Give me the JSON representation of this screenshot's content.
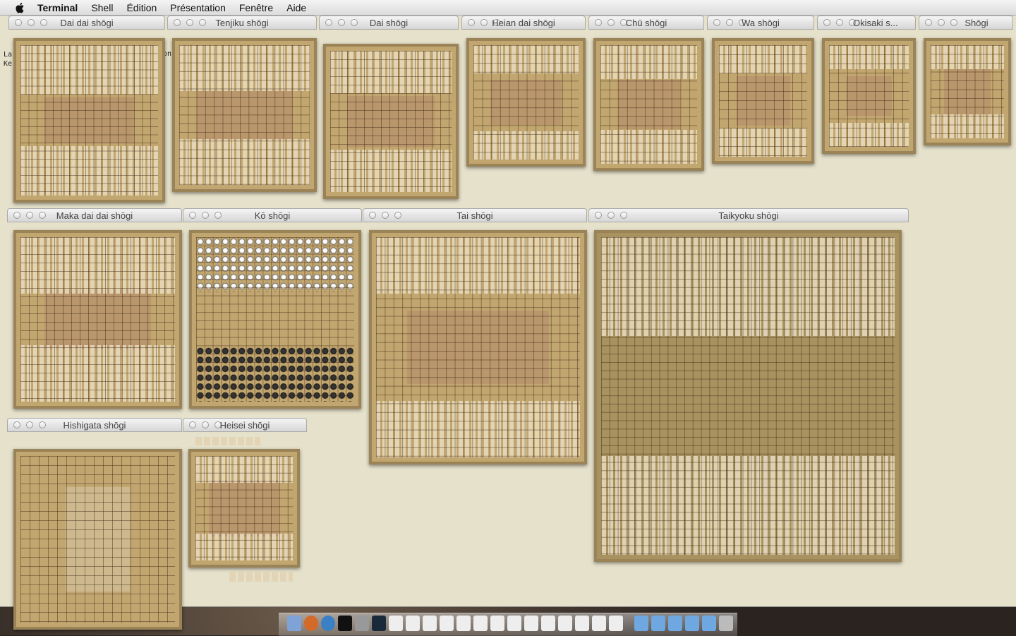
{
  "menubar": {
    "app_name": "Terminal",
    "items": [
      "Shell",
      "Édition",
      "Présentation",
      "Fenêtre",
      "Aide"
    ]
  },
  "terminal": {
    "lines": [
      "La",
      "Ke"
    ],
    "line_fragment": "on"
  },
  "windows": [
    {
      "id": "dai-dai",
      "title": "Dai dai shōgi"
    },
    {
      "id": "tenjiku",
      "title": "Tenjiku shōgi"
    },
    {
      "id": "dai",
      "title": "Dai shōgi"
    },
    {
      "id": "heian-dai",
      "title": "Heian dai shōgi"
    },
    {
      "id": "chu",
      "title": "Chū shōgi"
    },
    {
      "id": "wa",
      "title": "Wa shōgi"
    },
    {
      "id": "okisaki",
      "title": "Okisaki s..."
    },
    {
      "id": "shogi",
      "title": "Shōgi"
    },
    {
      "id": "maka-dai-dai",
      "title": "Maka dai dai shōgi"
    },
    {
      "id": "ko",
      "title": "Kō shōgi"
    },
    {
      "id": "tai",
      "title": "Tai shōgi"
    },
    {
      "id": "taikyoku",
      "title": "Taikyoku shōgi"
    },
    {
      "id": "hishigata",
      "title": "Hishigata shōgi"
    },
    {
      "id": "heisei",
      "title": "Heisei shōgi"
    }
  ],
  "colors": {
    "board": "#c2a66f",
    "board_border": "#9b8358",
    "terminal_bg": "#e6e1cb"
  }
}
